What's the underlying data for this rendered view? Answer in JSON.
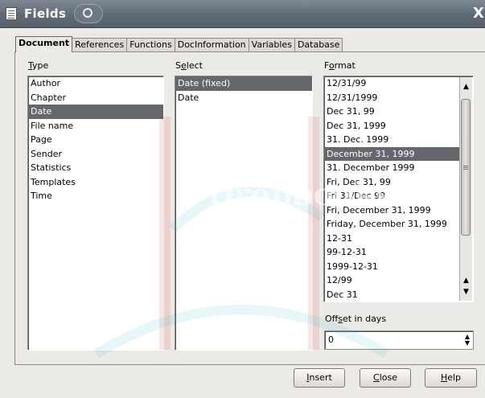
{
  "window": {
    "title": "Fields",
    "close_glyph": "X"
  },
  "tabs": [
    "Document",
    "References",
    "Functions",
    "DocInformation",
    "Variables",
    "Database"
  ],
  "active_tab": "Document",
  "type_list": {
    "label_first": "T",
    "label_rest": "ype",
    "items": [
      "Author",
      "Chapter",
      "Date",
      "File name",
      "Page",
      "Sender",
      "Statistics",
      "Templates",
      "Time"
    ],
    "selected": "Date"
  },
  "select_list": {
    "label_first": "S",
    "label_second": "e",
    "label_rest": "lect",
    "items": [
      "Date (fixed)",
      "Date"
    ],
    "selected": "Date (fixed)"
  },
  "format_list": {
    "label_first": "F",
    "label_second": "o",
    "label_rest": "rmat",
    "items": [
      "12/31/99",
      "12/31/1999",
      "Dec 31, 99",
      "Dec 31, 1999",
      "31. Dec. 1999",
      "December 31, 1999",
      "31. December 1999",
      "Fri, Dec 31, 99",
      "Fri 31/Dec 99",
      "Fri, December 31, 1999",
      "Friday, December 31, 1999",
      "12-31",
      "99-12-31",
      "1999-12-31",
      "12/99",
      "Dec 31"
    ],
    "selected": "December 31, 1999"
  },
  "offset": {
    "label_before": "Off",
    "label_key": "s",
    "label_after": "et in days",
    "value": "0"
  },
  "buttons": {
    "insert": {
      "key": "I",
      "rest": "nsert"
    },
    "close": {
      "key": "C",
      "rest": "lose"
    },
    "help": {
      "key": "H",
      "rest": "elp"
    }
  },
  "watermark": {
    "text": "Dropbooks",
    "color_red": "#cc3333",
    "color_teal": "#38b2c4"
  }
}
